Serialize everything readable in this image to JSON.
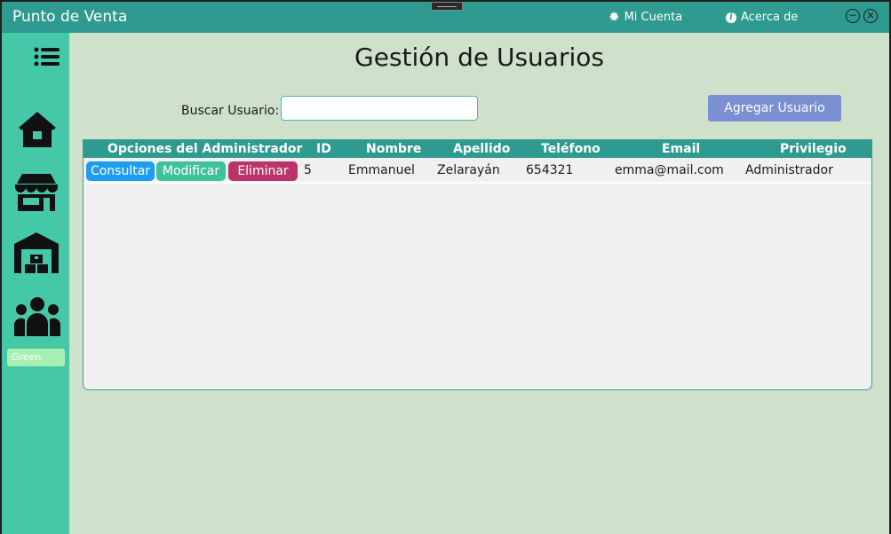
{
  "app": {
    "title": "Punto de Venta"
  },
  "titlebar": {
    "account_label": "Mi Cuenta",
    "account_icon": "gear-icon",
    "about_label": "Acerca de",
    "about_icon": "info-icon",
    "minimize_glyph": "−",
    "close_glyph": "×"
  },
  "sidebar": {
    "items": [
      {
        "name": "menu-icon"
      },
      {
        "name": "home-icon"
      },
      {
        "name": "store-icon"
      },
      {
        "name": "warehouse-icon"
      },
      {
        "name": "users-icon"
      }
    ],
    "theme_label": "Green"
  },
  "page": {
    "title": "Gestión de Usuarios"
  },
  "search": {
    "label": "Buscar Usuario:",
    "value": "",
    "placeholder": ""
  },
  "actions": {
    "add_user": "Agregar Usuario"
  },
  "table": {
    "headers": {
      "options": "Opciones del Administrador",
      "id": "ID",
      "name": "Nombre",
      "surname": "Apellido",
      "phone": "Teléfono",
      "email": "Email",
      "privilege": "Privilegio"
    },
    "rows": [
      {
        "consult": "Consultar",
        "modify": "Modificar",
        "delete": "Eliminar",
        "id": "5",
        "name": "Emmanuel",
        "surname": "Zelarayán",
        "phone": "654321",
        "email": "emma@mail.com",
        "privilege": "Administrador"
      }
    ]
  },
  "colors": {
    "titlebar": "#2f9a8f",
    "sidebar": "#45c8a8",
    "background": "#cfe1cb",
    "consult_button": "#1e9cf0",
    "modify_button": "#3fc29a",
    "delete_button": "#b93569",
    "add_button": "#7b8fd3"
  }
}
